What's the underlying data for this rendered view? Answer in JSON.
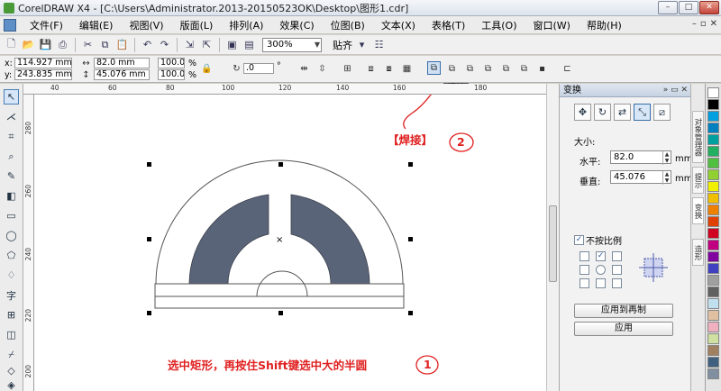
{
  "window": {
    "title": "CorelDRAW X4 - [C:\\Users\\Administrator.2013-20150523OK\\Desktop\\图形1.cdr]",
    "min": "–",
    "max": "□",
    "close": "✕"
  },
  "menu": [
    "文件(F)",
    "编辑(E)",
    "视图(V)",
    "版面(L)",
    "排列(A)",
    "效果(C)",
    "位图(B)",
    "文本(X)",
    "表格(T)",
    "工具(O)",
    "窗口(W)",
    "帮助(H)"
  ],
  "mdi": {
    "min": "–",
    "restore": "▫",
    "close": "✕"
  },
  "toolbar": {
    "zoom": "300%",
    "snap": "贴齐"
  },
  "propbar": {
    "x_label": "x:",
    "x_value": "114.927 mm",
    "y_label": "y:",
    "y_value": "243.835 mm",
    "w_value": "82.0 mm",
    "h_value": "45.076 mm",
    "scale_x": "100.0",
    "scale_y": "100.0",
    "pct": "%",
    "angle": ".0",
    "deg": "°"
  },
  "tooltip": "焊接",
  "ruler": {
    "h": [
      "40",
      "60",
      "80",
      "100",
      "120",
      "140",
      "160",
      "180"
    ],
    "v": [
      "280",
      "260",
      "240",
      "220",
      "200"
    ]
  },
  "annotations": {
    "weld": "【焊接】",
    "step2": "2",
    "step1": "1",
    "instruction": "选中矩形，再按住Shift键选中大的半圆"
  },
  "docker": {
    "title": "变换",
    "size_label": "大小:",
    "horizontal_label": "水平:",
    "horizontal_value": "82.0",
    "horizontal_unit": "mm",
    "vertical_label": "垂直:",
    "vertical_value": "45.076",
    "vertical_unit": "mm",
    "nonprop_label": "不按比例",
    "apply_duplicate": "应用到再制",
    "apply": "应用"
  },
  "sidetabs": [
    "对象管理器",
    "提示",
    "变换",
    "造形"
  ],
  "palette": [
    "#ffffff",
    "#000000",
    "#00a0e0",
    "#0080c0",
    "#00a0a0",
    "#20b060",
    "#50c040",
    "#90d030",
    "#f0f000",
    "#f0c000",
    "#f08000",
    "#e04000",
    "#d00020",
    "#c00080",
    "#8000a0",
    "#4040c0",
    "#a0a0a0",
    "#606060",
    "#c0e0f0",
    "#e0c0a0",
    "#f0b0c0",
    "#d0e0a0",
    "#a08060",
    "#406080",
    "#8090a0"
  ],
  "shape_fill": "#5a6478"
}
